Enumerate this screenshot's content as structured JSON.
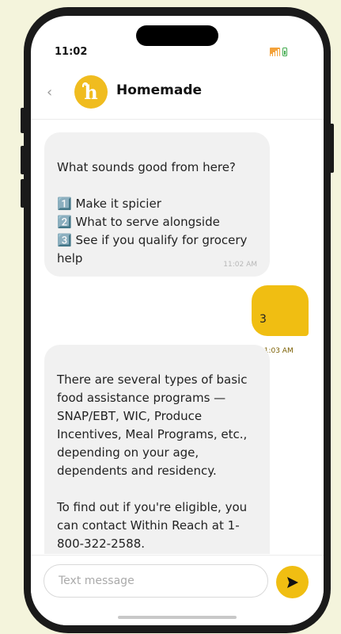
{
  "status_bar": {
    "time": "11:02"
  },
  "header": {
    "back_icon": "‹",
    "avatar_letter": "h",
    "title": "Homemade"
  },
  "messages": [
    {
      "from": "bot",
      "text": "What sounds good from here?\n\n1️⃣ Make it spicier\n2️⃣ What to serve alongside\n3️⃣ See if you qualify for grocery help",
      "time": "11:02 AM"
    },
    {
      "from": "user",
      "text": "3",
      "time": "11:03 AM"
    },
    {
      "from": "bot",
      "text": "There are several types of basic food assistance programs — SNAP/EBT, WIC, Produce Incentives, Meal Programs, etc., depending on your age, dependents and residency.\n\nTo find out if you're eligible, you can contact Within Reach at 1-800-322-2588."
    }
  ],
  "composer": {
    "placeholder": "Text message"
  },
  "colors": {
    "accent": "#f0be12",
    "incoming_bubble": "#f1f1f1",
    "background": "#f4f4dc"
  }
}
